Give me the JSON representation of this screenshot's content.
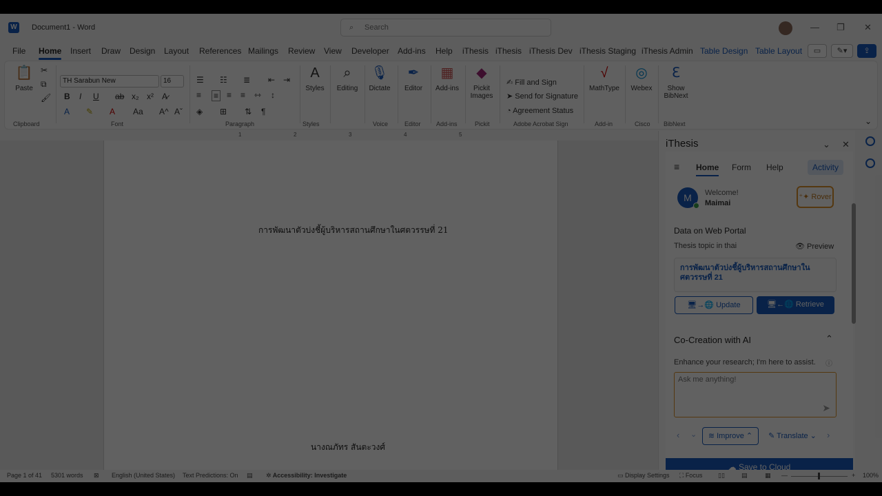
{
  "titlebar": {
    "doc_name": "Document1",
    "app_name": "Word",
    "search_placeholder": "Search",
    "minimize": "—",
    "restore": "❐",
    "close": "✕"
  },
  "menu": {
    "tabs": [
      "File",
      "Home",
      "Insert",
      "Draw",
      "Design",
      "Layout",
      "References",
      "Mailings",
      "Review",
      "View",
      "Developer",
      "Add-ins",
      "Help",
      "iThesis",
      "iThesis",
      "iThesis Dev",
      "iThesis Staging",
      "iThesis Admin",
      "Table Design",
      "Table Layout"
    ],
    "active": "Home"
  },
  "ribbon": {
    "paste_label": "Paste",
    "font_name": "TH Sarabun New",
    "font_size": "16",
    "group_labels": {
      "clipboard": "Clipboard",
      "font": "Font",
      "paragraph": "Paragraph",
      "styles": "Styles",
      "voice": "Voice",
      "editor": "Editor",
      "addins": "Add-ins",
      "pickit": "Pickit",
      "acrobat": "Adobe Acrobat Sign",
      "addin": "Add-in",
      "cisco": "Cisco",
      "bibnext": "BibNext"
    },
    "buttons": {
      "styles": "Styles",
      "editing": "Editing",
      "dictate": "Dictate",
      "editor": "Editor",
      "addins": "Add-ins",
      "pickit": "Pickit Images",
      "fill_sign": "Fill and Sign",
      "send_signature": "Send for Signature",
      "agreement_status": "Agreement Status",
      "mathtype": "MathType",
      "webex": "Webex",
      "show_bibnext": "Show BibNext"
    }
  },
  "ruler": {
    "marks": [
      "1",
      "2",
      "3",
      "4",
      "5"
    ]
  },
  "document": {
    "title_line": "การพัฒนาตัวบ่งชี้ผู้บริหารสถานศึกษาในศตวรรษที่ 21",
    "author_line": "นางณภัทร สันตะวงศ์"
  },
  "pane": {
    "title": "iThesis",
    "nav": [
      "Home",
      "Form",
      "Help"
    ],
    "activity": "Activity",
    "avatar_letter": "M",
    "welcome": "Welcome!",
    "user": "Maimai",
    "rover": "Rover",
    "data_portal": "Data on Web Portal",
    "topic_label": "Thesis topic in thai",
    "preview": "Preview",
    "topic_text": "การพัฒนาตัวบ่งชี้ผู้บริหารสถานศึกษาใน ศตวรรษที่ 21",
    "update": "Update",
    "retrieve": "Retrieve",
    "cocreation": "Co-Creation with AI",
    "enhance": "Enhance your research; I'm here to assist.",
    "ask_placeholder": "Ask me anything!",
    "improve": "Improve",
    "translate": "Translate",
    "save": "Save to Cloud"
  },
  "status": {
    "page": "Page 1 of 41",
    "words": "5301 words",
    "language": "English (United States)",
    "predictions": "Text Predictions: On",
    "accessibility": "Accessibility: Investigate",
    "display": "Display Settings",
    "focus": "Focus",
    "zoom": "100%"
  }
}
